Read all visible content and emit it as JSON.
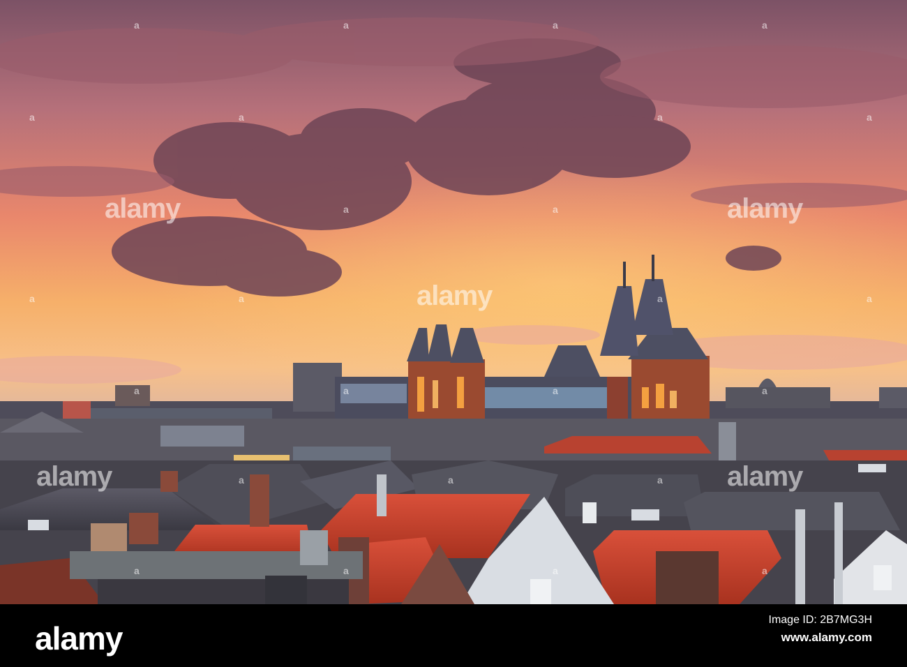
{
  "photo": {
    "sky_top_color": "#8e5a6e",
    "sky_mid_color": "#e9876c",
    "sky_horizon_color": "#f5b566",
    "roof_tile_color": "#c9402c",
    "building_glow_color": "#f0a050"
  },
  "watermark": {
    "text": "alamy",
    "small_mark": "a"
  },
  "footer": {
    "logo": "alamy",
    "image_id_label": "Image ID: 2B7MG3H",
    "site": "www.alamy.com"
  }
}
